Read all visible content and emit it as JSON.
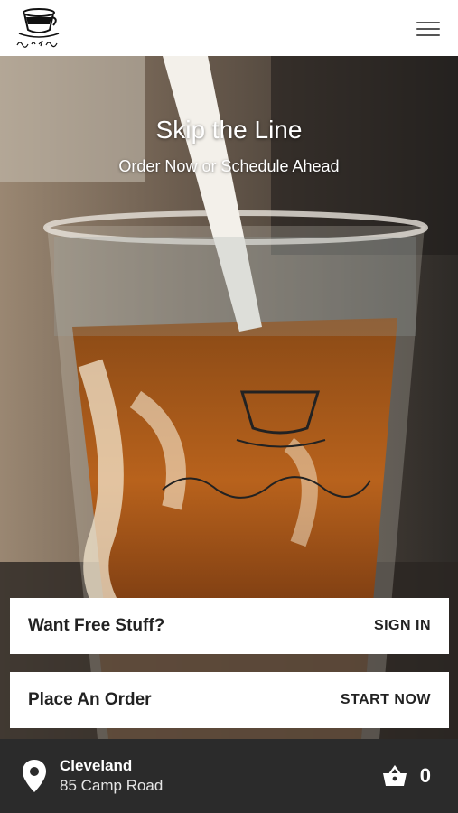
{
  "header": {
    "logo_icon": "coffee-cup-logo",
    "logo_script": "Kind & Kup",
    "menu_icon": "hamburger-menu-icon"
  },
  "hero": {
    "title": "Skip the Line",
    "subtitle": "Order Now or Schedule Ahead",
    "image": "iced coffee in plastic cup with cream being poured"
  },
  "rewards_card": {
    "title": "Want Free Stuff?",
    "action": "SIGN IN"
  },
  "order_card": {
    "title": "Place An Order",
    "action": "START NOW"
  },
  "footer": {
    "location_icon": "map-pin-icon",
    "city": "Cleveland",
    "address": "85 Camp Road",
    "cart_icon": "basket-icon",
    "cart_count": "0"
  },
  "colors": {
    "footer_bg": "#2b2b2b",
    "card_bg": "#ffffff",
    "text": "#222222"
  }
}
